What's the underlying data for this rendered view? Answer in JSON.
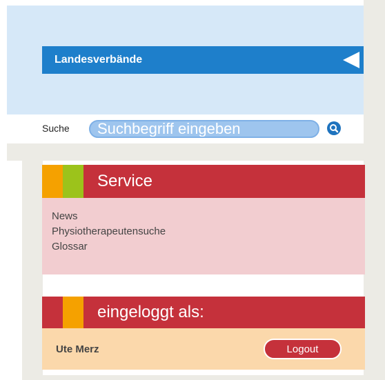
{
  "landesverbaende": {
    "label": "Landesverbände",
    "icon": "arrow-left-icon"
  },
  "search": {
    "label": "Suche",
    "placeholder": "Suchbegriff eingeben",
    "icon": "search-icon"
  },
  "service": {
    "title": "Service",
    "links": [
      "News",
      "Physiotherapeutensuche",
      "Glossar"
    ]
  },
  "login": {
    "title": "eingeloggt als:",
    "user": "Ute Merz",
    "logout_label": "Logout"
  },
  "colors": {
    "blue_bar": "#1e7fcb",
    "light_blue": "#d6e8f8",
    "red": "#c5313b",
    "pink": "#f2cdd0",
    "peach": "#fbd8ab",
    "orange_stripe": "#f5a100",
    "green_stripe": "#9cc31b"
  }
}
